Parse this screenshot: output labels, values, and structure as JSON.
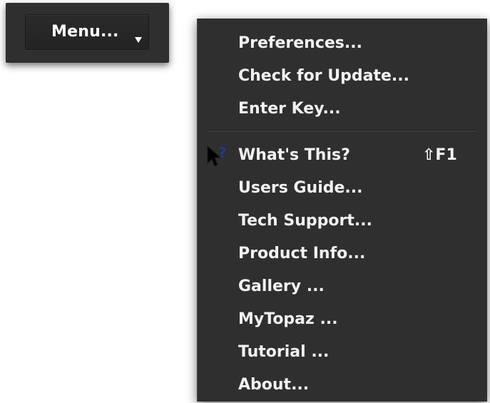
{
  "menu_button": {
    "label": "Menu...",
    "arrow_icon": "chevron-down-icon"
  },
  "dropdown": {
    "items_top": [
      {
        "label": "Preferences..."
      },
      {
        "label": "Check for Update..."
      },
      {
        "label": "Enter Key..."
      }
    ],
    "items_bottom": [
      {
        "label": "What's This?",
        "shortcut": "⇧F1",
        "icon": "whats-this-icon"
      },
      {
        "label": "Users Guide..."
      },
      {
        "label": "Tech Support..."
      },
      {
        "label": "Product Info..."
      },
      {
        "label": "Gallery ..."
      },
      {
        "label": "MyTopaz ..."
      },
      {
        "label": "Tutorial ..."
      },
      {
        "label": "About..."
      }
    ]
  },
  "colors": {
    "panel_bg": "#2f2f2f",
    "text": "#f2f2f2",
    "help_icon_question": "#1f3a93"
  }
}
